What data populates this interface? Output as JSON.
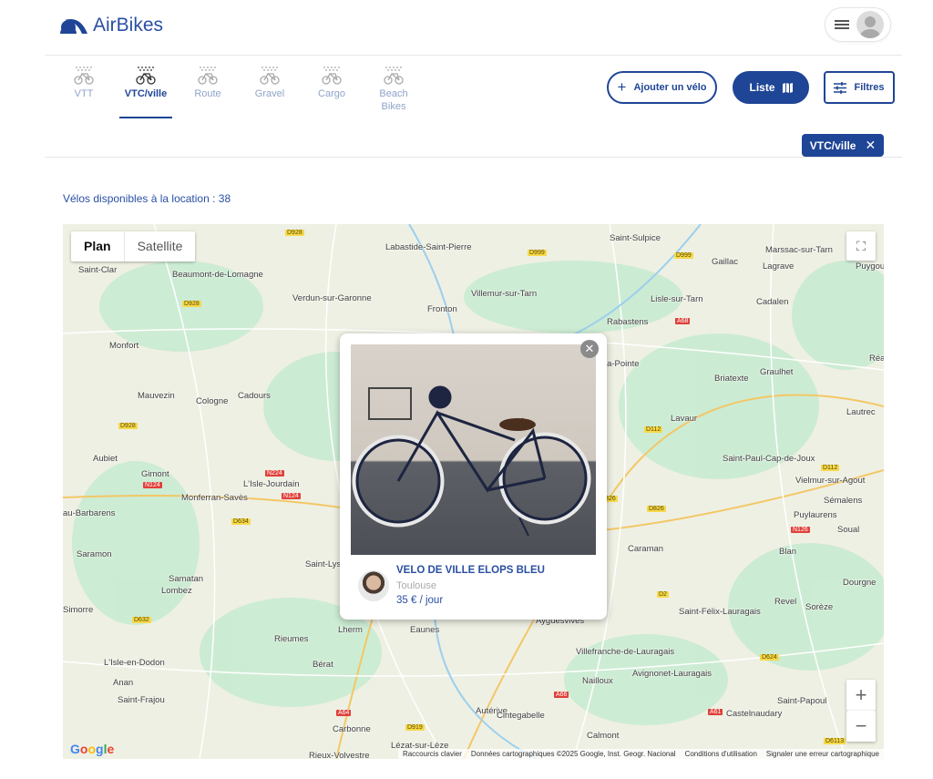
{
  "header": {
    "brand": "AirBikes"
  },
  "categories": [
    {
      "label": "VTT",
      "active": false
    },
    {
      "label": "VTC/ville",
      "active": true
    },
    {
      "label": "Route",
      "active": false
    },
    {
      "label": "Gravel",
      "active": false
    },
    {
      "label": "Cargo",
      "active": false
    },
    {
      "label": "Beach Bikes",
      "active": false
    }
  ],
  "actions": {
    "add": "Ajouter un vélo",
    "list": "Liste",
    "filters": "Filtres"
  },
  "active_filter": "VTC/ville",
  "count_text": "Vélos disponibles à la location : 38",
  "map": {
    "type_options": [
      "Plan",
      "Satellite"
    ],
    "selected_type": "Plan",
    "places": [
      "Saint-Clar",
      "Beaumont-de-Lomagne",
      "Labastide-Saint-Pierre",
      "Verdun-sur-Garonne",
      "Villemur-sur-Tarn",
      "Fronton",
      "Gaillac",
      "Lagrave",
      "Marssac-sur-Tarn",
      "Lisle-sur-Tarn",
      "Rabastens",
      "Cadalen",
      "Monfort",
      "Mauvezin",
      "Cologne",
      "Cadours",
      "Briatexte",
      "Graulhet",
      "Lavaur",
      "Lautrec",
      "Aubiet",
      "Gimont",
      "L'Isle-Jourdain",
      "Monferran-Savès",
      "Saint-Paul-Cap-de-Joux",
      "Vielmur-sur-Agout",
      "Sémalens",
      "Puylaurens",
      "Soual",
      "Saramon",
      "Samatan",
      "Lombez",
      "Caraman",
      "Blan",
      "Simorre",
      "Revel",
      "Sorèze",
      "Dourgne",
      "Rieumes",
      "Lherm",
      "Eaunes",
      "Ayguesvives",
      "Saint-Félix-Lauragais",
      "L'Isle-en-Dodon",
      "Bérat",
      "Villefranche-de-Lauragais",
      "Anan",
      "Saint-Frajou",
      "Nailloux",
      "Avignonet-Lauragais",
      "Autérive",
      "Carbonne",
      "Cintegabelle",
      "Castelnaudary",
      "Saint-Papoul",
      "Calmont",
      "Lézat-sur-Lèze",
      "Rieux-Volvestre",
      "Saint-Lys",
      "Puygou",
      "Réa",
      "la-Pointe",
      "Saint-Sulpice",
      "au-Barbarens"
    ],
    "roads": [
      "D928",
      "D999",
      "D999",
      "D928",
      "A68",
      "D928",
      "N224",
      "N124",
      "N124",
      "D634",
      "D112",
      "D112",
      "D826",
      "D826",
      "N126",
      "D632",
      "D2",
      "D624",
      "A64",
      "D919",
      "A66",
      "A61",
      "D6113"
    ],
    "attribution": [
      "Raccourcis clavier",
      "Données cartographiques ©2025 Google, Inst. Geogr. Nacional",
      "Conditions d'utilisation",
      "Signaler une erreur cartographique"
    ],
    "google": "Google"
  },
  "listing": {
    "title": "VELO DE VILLE ELOPS BLEU",
    "city": "Toulouse",
    "price": "35 € / jour"
  },
  "colors": {
    "primary": "#1f4596",
    "water": "#a8d5f0",
    "green": "#b7e6c8"
  }
}
